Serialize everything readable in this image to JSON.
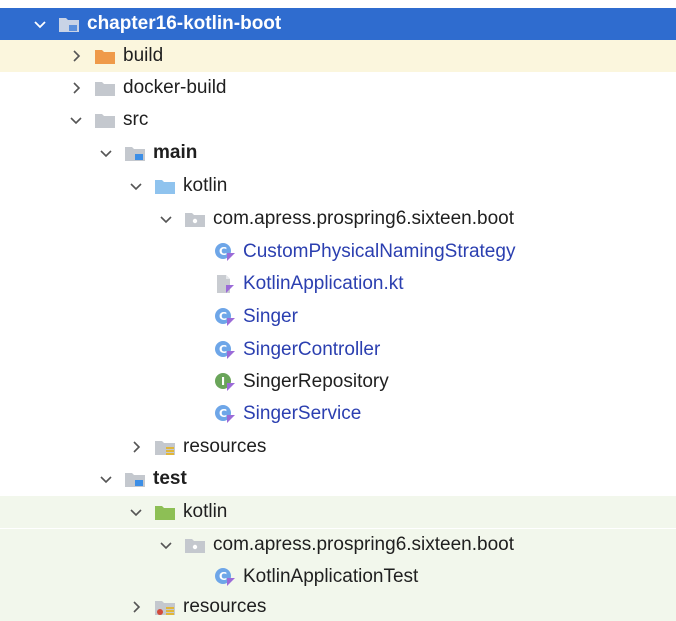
{
  "tree": {
    "root": {
      "label": "chapter16-kotlin-boot",
      "icon": "module-folder-icon",
      "expanded": true
    },
    "build": {
      "label": "build",
      "icon": "excluded-folder-icon"
    },
    "docker_build": {
      "label": "docker-build",
      "icon": "folder-icon"
    },
    "src": {
      "label": "src",
      "icon": "folder-icon",
      "expanded": true
    },
    "main": {
      "label": "main",
      "icon": "source-root-folder-icon",
      "expanded": true
    },
    "main_kotlin": {
      "label": "kotlin",
      "icon": "source-folder-icon",
      "expanded": true
    },
    "main_package": {
      "label": "com.apress.prospring6.sixteen.boot",
      "icon": "package-icon",
      "expanded": true
    },
    "main_files": [
      {
        "label": "CustomPhysicalNamingStrategy",
        "icon": "kotlin-class-icon"
      },
      {
        "label": "KotlinApplication.kt",
        "icon": "kotlin-file-icon"
      },
      {
        "label": "Singer",
        "icon": "kotlin-class-icon"
      },
      {
        "label": "SingerController",
        "icon": "kotlin-class-icon"
      },
      {
        "label": "SingerRepository",
        "icon": "kotlin-interface-icon"
      },
      {
        "label": "SingerService",
        "icon": "kotlin-class-icon"
      }
    ],
    "main_resources": {
      "label": "resources",
      "icon": "resources-folder-icon"
    },
    "test": {
      "label": "test",
      "icon": "test-root-folder-icon",
      "expanded": true
    },
    "test_kotlin": {
      "label": "kotlin",
      "icon": "test-source-folder-icon",
      "expanded": true
    },
    "test_package": {
      "label": "com.apress.prospring6.sixteen.boot",
      "icon": "package-icon",
      "expanded": true
    },
    "test_files": [
      {
        "label": "KotlinApplicationTest",
        "icon": "kotlin-class-icon"
      }
    ],
    "test_resources": {
      "label": "resources",
      "icon": "test-resources-folder-icon"
    }
  },
  "colors": {
    "selection": "#2f6ccf",
    "build_highlight": "#fbf6dd",
    "test_highlight": "#f2f7ec",
    "file_name_blue": "#2b3fb0"
  }
}
